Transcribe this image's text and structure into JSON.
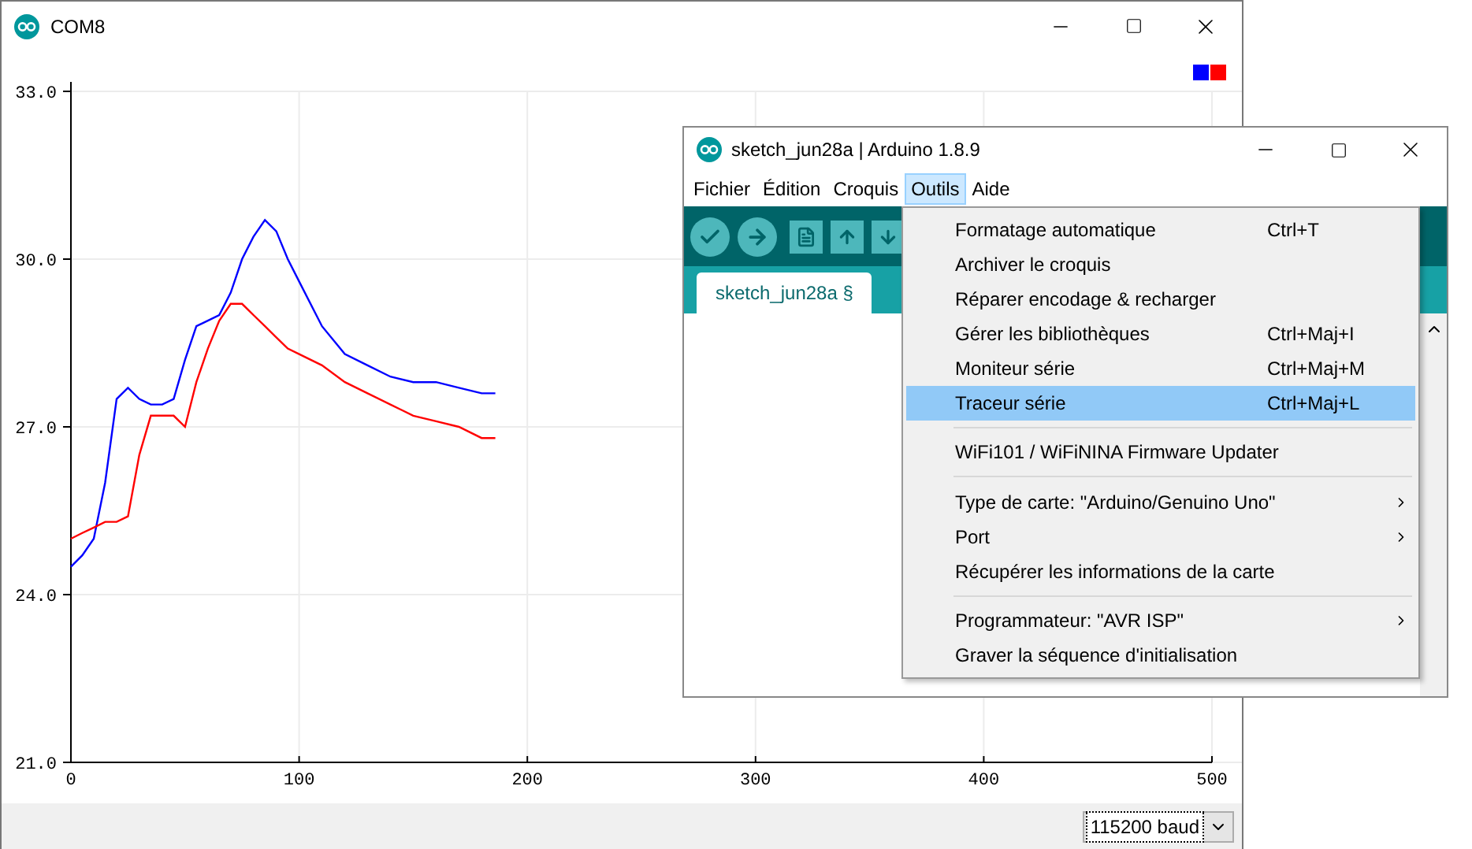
{
  "plotter_window": {
    "title": "COM8",
    "legend": [
      {
        "color": "#0000ff"
      },
      {
        "color": "#ff0000"
      }
    ],
    "chart_data": {
      "type": "line",
      "x": [
        0,
        5,
        10,
        15,
        20,
        25,
        30,
        35,
        40,
        45,
        50,
        55,
        60,
        65,
        70,
        75,
        80,
        85,
        90,
        95,
        100,
        110,
        120,
        130,
        140,
        150,
        160,
        170,
        180,
        186
      ],
      "series": [
        {
          "color": "#0000ff",
          "values": [
            24.5,
            24.7,
            25.0,
            26.0,
            27.5,
            27.7,
            27.5,
            27.4,
            27.4,
            27.5,
            28.2,
            28.8,
            28.9,
            29.0,
            29.4,
            30.0,
            30.4,
            30.7,
            30.5,
            30.0,
            29.6,
            28.8,
            28.3,
            28.1,
            27.9,
            27.8,
            27.8,
            27.7,
            27.6,
            27.6
          ]
        },
        {
          "color": "#ff0000",
          "values": [
            25.0,
            25.1,
            25.2,
            25.3,
            25.3,
            25.4,
            26.5,
            27.2,
            27.2,
            27.2,
            27.0,
            27.8,
            28.4,
            28.9,
            29.2,
            29.2,
            29.0,
            28.8,
            28.6,
            28.4,
            28.3,
            28.1,
            27.8,
            27.6,
            27.4,
            27.2,
            27.1,
            27.0,
            26.8,
            26.8
          ]
        }
      ],
      "grid": true,
      "xlim": [
        0,
        500
      ],
      "ylim": [
        21,
        33
      ],
      "xticks": [
        0,
        100,
        200,
        300,
        400,
        500
      ],
      "yticks": [
        {
          "value": 21,
          "label": "21.0"
        },
        {
          "value": 24,
          "label": "24.0"
        },
        {
          "value": 27,
          "label": "27.0"
        },
        {
          "value": 30,
          "label": "30.0"
        },
        {
          "value": 33,
          "label": "33.0"
        }
      ]
    },
    "baud_select": {
      "value": "115200 baud"
    }
  },
  "ide_window": {
    "title": "sketch_jun28a | Arduino 1.8.9",
    "menu_bar": [
      {
        "label": "Fichier",
        "selected": false
      },
      {
        "label": "Édition",
        "selected": false
      },
      {
        "label": "Croquis",
        "selected": false
      },
      {
        "label": "Outils",
        "selected": true
      },
      {
        "label": "Aide",
        "selected": false
      }
    ],
    "tabs": [
      {
        "label": "sketch_jun28a §",
        "selected": true
      }
    ],
    "menu": [
      {
        "kind": "item",
        "label": "Formatage automatique",
        "shortcut": "Ctrl+T",
        "submenu": false,
        "selected": false
      },
      {
        "kind": "item",
        "label": "Archiver le croquis",
        "submenu": false,
        "selected": false
      },
      {
        "kind": "item",
        "label": "Réparer encodage & recharger",
        "submenu": false,
        "selected": false
      },
      {
        "kind": "item",
        "label": "Gérer les bibliothèques",
        "shortcut": "Ctrl+Maj+I",
        "submenu": false,
        "selected": false
      },
      {
        "kind": "item",
        "label": "Moniteur série",
        "shortcut": "Ctrl+Maj+M",
        "submenu": false,
        "selected": false
      },
      {
        "kind": "item",
        "label": "Traceur série",
        "shortcut": "Ctrl+Maj+L",
        "submenu": false,
        "selected": true
      },
      {
        "kind": "separator"
      },
      {
        "kind": "item",
        "label": "WiFi101 / WiFiNINA Firmware Updater",
        "submenu": false,
        "selected": false
      },
      {
        "kind": "separator"
      },
      {
        "kind": "item",
        "label": "Type de carte: \"Arduino/Genuino Uno\"",
        "submenu": true,
        "selected": false
      },
      {
        "kind": "item",
        "label": "Port",
        "submenu": true,
        "selected": false
      },
      {
        "kind": "item",
        "label": "Récupérer les informations de la carte",
        "submenu": false,
        "selected": false
      },
      {
        "kind": "separator"
      },
      {
        "kind": "item",
        "label": "Programmateur: \"AVR ISP\"",
        "submenu": true,
        "selected": false
      },
      {
        "kind": "item",
        "label": "Graver la séquence d'initialisation",
        "submenu": false,
        "selected": false
      }
    ]
  }
}
